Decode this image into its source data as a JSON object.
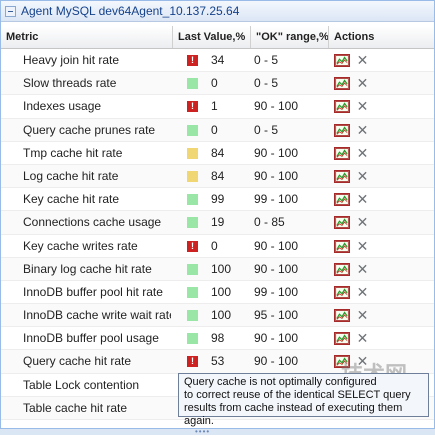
{
  "panel": {
    "title": "Agent MySQL dev64Agent_10.137.25.64"
  },
  "columns": {
    "metric": "Metric",
    "last_value": "Last Value,%",
    "ok_range": "\"OK\" range,%",
    "actions": "Actions"
  },
  "rows": [
    {
      "metric": "Heavy join hit rate",
      "status": "crit",
      "value": "34",
      "range": "0 - 5"
    },
    {
      "metric": "Slow threads rate",
      "status": "ok",
      "value": "0",
      "range": "0 - 5"
    },
    {
      "metric": "Indexes usage",
      "status": "crit",
      "value": "1",
      "range": "90 - 100"
    },
    {
      "metric": "Query cache prunes rate",
      "status": "ok",
      "value": "0",
      "range": "0 - 5"
    },
    {
      "metric": "Tmp cache hit rate",
      "status": "warn",
      "value": "84",
      "range": "90 - 100"
    },
    {
      "metric": "Log cache hit rate",
      "status": "warn",
      "value": "84",
      "range": "90 - 100"
    },
    {
      "metric": "Key cache hit rate",
      "status": "ok",
      "value": "99",
      "range": "99 - 100"
    },
    {
      "metric": "Connections cache usage",
      "status": "ok",
      "value": "19",
      "range": "0 - 85"
    },
    {
      "metric": "Key cache writes rate",
      "status": "crit",
      "value": "0",
      "range": "90 - 100"
    },
    {
      "metric": "Binary log cache hit rate",
      "status": "ok",
      "value": "100",
      "range": "90 - 100"
    },
    {
      "metric": "InnoDB buffer pool hit rate",
      "status": "ok",
      "value": "100",
      "range": "99 - 100"
    },
    {
      "metric": "InnoDB cache write wait rate",
      "status": "ok",
      "value": "100",
      "range": "95 - 100"
    },
    {
      "metric": "InnoDB buffer pool usage",
      "status": "ok",
      "value": "98",
      "range": "90 - 100"
    },
    {
      "metric": "Query cache hit rate",
      "status": "crit",
      "value": "53",
      "range": "90 - 100"
    },
    {
      "metric": "Table Lock contention",
      "status": "",
      "value": "",
      "range": ""
    },
    {
      "metric": "Table cache hit rate",
      "status": "",
      "value": "",
      "range": ""
    }
  ],
  "tooltip": {
    "line1": "Query cache is not optimally configured",
    "line2": "to correct reuse of the identical SELECT query",
    "line3": "results from cache instead of executing them again."
  },
  "icons": {
    "critical_mark": "!",
    "graph": "graph-icon",
    "delete": "close-icon"
  },
  "colors": {
    "ok": "#99e6a6",
    "warn": "#f1d674",
    "crit": "#cc2222"
  },
  "watermark": {
    "text": "技术网",
    "url": "www.itjs.cn"
  }
}
